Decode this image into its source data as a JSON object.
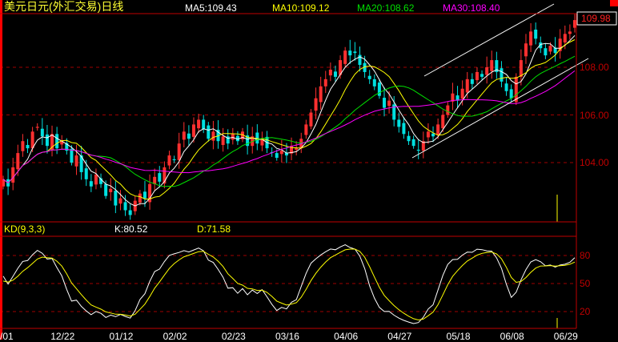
{
  "header": {
    "title": "美元日元(外汇交易)日线",
    "ma5_label": "MA5:109.43",
    "ma10_label": "MA10:109.12",
    "ma20_label": "MA20:108.62",
    "ma30_label": "MA30:108.40",
    "last_price": "109.98"
  },
  "kd_header": {
    "name": "KD(9,3,3)",
    "k_label": "K:80.52",
    "d_label": "D:71.58"
  },
  "colors": {
    "up": "#ff3030",
    "down": "#00e0e0",
    "ma5": "#ffffff",
    "ma10": "#ffff00",
    "ma20": "#00e000",
    "ma30": "#ff00ff",
    "k": "#ffffff",
    "d": "#ffff00",
    "frame": "#c00000",
    "axis_text": "#c00000"
  },
  "chart_data": {
    "type": "candlestick",
    "title": "美元日元(外汇交易)日线",
    "price_ticks": [
      "108.00",
      "106.00",
      "104.00"
    ],
    "price_tick_values": [
      108,
      106,
      104
    ],
    "price_range": [
      101.5,
      110.1
    ],
    "kd_ticks": [
      "80",
      "50",
      "20"
    ],
    "kd_tick_values": [
      80,
      50,
      20
    ],
    "x_labels": [
      "/01",
      "12/22",
      "01/12",
      "02/02",
      "02/23",
      "03/16",
      "04/06",
      "04/27",
      "05/18",
      "06/08",
      "06/29"
    ],
    "x_label_index": [
      0,
      12,
      24,
      35,
      47,
      58,
      70,
      81,
      93,
      104,
      115
    ],
    "closes": [
      103.3,
      103.0,
      103.8,
      104.4,
      104.9,
      104.6,
      105.3,
      105.5,
      105.1,
      104.7,
      105.2,
      104.6,
      104.9,
      104.5,
      104.0,
      104.3,
      103.6,
      103.3,
      103.0,
      103.5,
      103.1,
      102.6,
      102.9,
      102.2,
      102.5,
      102.0,
      101.8,
      102.4,
      102.7,
      102.5,
      103.1,
      103.4,
      103.2,
      103.8,
      104.3,
      104.1,
      104.8,
      105.3,
      105.0,
      105.6,
      105.8,
      105.4,
      105.0,
      105.3,
      104.9,
      105.1,
      104.8,
      105.2,
      104.9,
      105.3,
      104.7,
      105.1,
      104.8,
      105.0,
      104.6,
      104.4,
      104.2,
      104.5,
      104.3,
      104.7,
      104.6,
      105.0,
      105.6,
      106.1,
      106.7,
      107.2,
      107.5,
      107.9,
      107.6,
      108.3,
      108.7,
      108.5,
      108.6,
      108.1,
      107.8,
      107.5,
      107.2,
      106.8,
      106.3,
      106.6,
      105.8,
      105.5,
      105.2,
      104.9,
      104.7,
      104.5,
      104.9,
      105.3,
      105.1,
      105.6,
      106.0,
      106.4,
      106.9,
      106.6,
      107.1,
      107.5,
      107.3,
      107.8,
      107.6,
      108.0,
      108.3,
      107.8,
      107.4,
      107.0,
      106.7,
      107.6,
      108.3,
      109.0,
      109.5,
      109.2,
      108.8,
      108.5,
      108.9,
      108.6,
      109.2,
      109.4,
      109.5,
      109.98
    ],
    "moving_averages": [
      5,
      10,
      20,
      30
    ],
    "kd_params": [
      9,
      3,
      3
    ]
  }
}
